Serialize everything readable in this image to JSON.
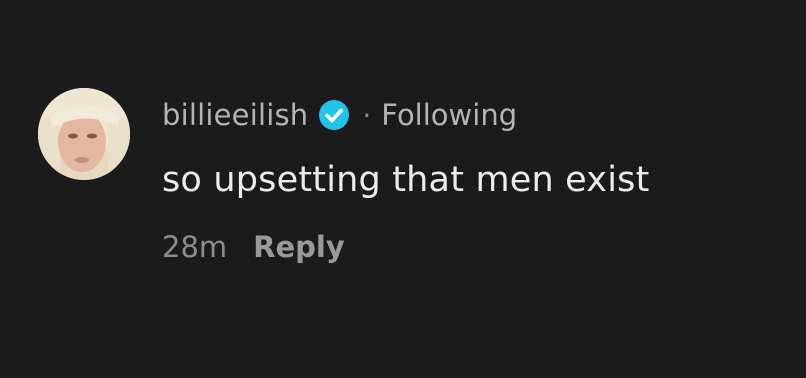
{
  "comment": {
    "avatar_icon": "user-avatar-icon",
    "username": "billieeilish",
    "verified_icon": "verified-badge-icon",
    "verified_color": "#20c4e8",
    "separator": "·",
    "follow_status": "Following",
    "text": "so upsetting that men exist",
    "timestamp": "28m",
    "reply_label": "Reply"
  },
  "colors": {
    "background": "#1b1b1b",
    "username": "#b4b4b4",
    "comment_text": "#ececec",
    "meta": "#8e8e8e"
  }
}
